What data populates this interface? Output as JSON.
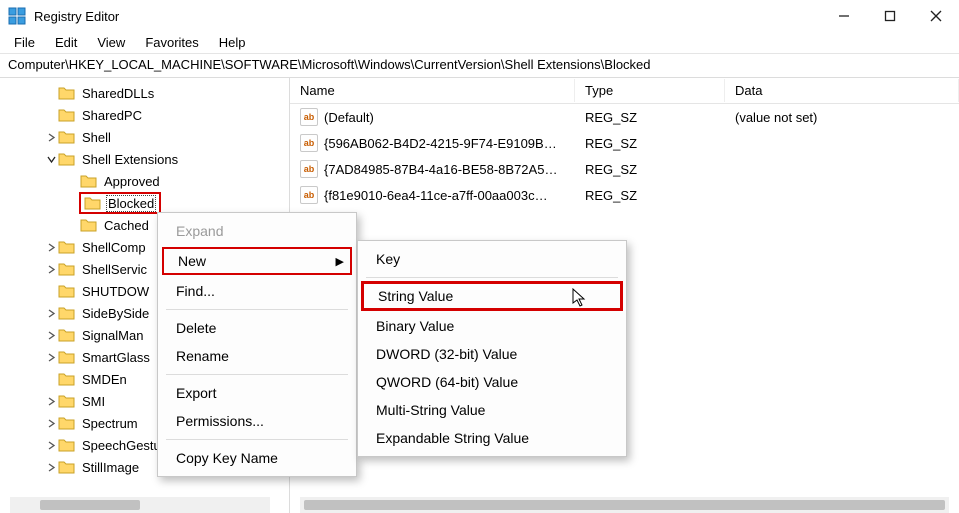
{
  "window": {
    "title": "Registry Editor"
  },
  "menubar": {
    "file": "File",
    "edit": "Edit",
    "view": "View",
    "favorites": "Favorites",
    "help": "Help"
  },
  "address": "Computer\\HKEY_LOCAL_MACHINE\\SOFTWARE\\Microsoft\\Windows\\CurrentVersion\\Shell Extensions\\Blocked",
  "tree": [
    {
      "label": "SharedDLLs",
      "indent": 38,
      "exp": ""
    },
    {
      "label": "SharedPC",
      "indent": 38,
      "exp": ""
    },
    {
      "label": "Shell",
      "indent": 38,
      "exp": "›",
      "exp_state": "collapsed"
    },
    {
      "label": "Shell Extensions",
      "indent": 38,
      "exp": "⌄",
      "exp_state": "expanded"
    },
    {
      "label": "Approved",
      "indent": 60,
      "exp": ""
    },
    {
      "label": "Blocked",
      "indent": 60,
      "exp": "",
      "selected": true,
      "highlight": true
    },
    {
      "label": "Cached",
      "indent": 60,
      "exp": ""
    },
    {
      "label": "ShellCompatibility",
      "display": "ShellComp",
      "indent": 38,
      "exp": "›"
    },
    {
      "label": "ShellServiceObjectDelayLoad",
      "display": "ShellServic",
      "indent": 38,
      "exp": "›"
    },
    {
      "label": "SHUTDOWN",
      "display": "SHUTDOW",
      "indent": 38,
      "exp": ""
    },
    {
      "label": "SideBySide",
      "display": "SideBySide",
      "indent": 38,
      "exp": "›"
    },
    {
      "label": "SignalManager",
      "display": "SignalMan",
      "indent": 38,
      "exp": "›"
    },
    {
      "label": "SmartGlass",
      "display": "SmartGlass",
      "indent": 38,
      "exp": "›"
    },
    {
      "label": "SMDEn",
      "indent": 38,
      "exp": ""
    },
    {
      "label": "SMI",
      "indent": 38,
      "exp": "›"
    },
    {
      "label": "Spectrum",
      "indent": 38,
      "exp": "›"
    },
    {
      "label": "SpeechGestures",
      "display": "SpeechGestures",
      "indent": 38,
      "exp": "›"
    },
    {
      "label": "StillImage",
      "indent": 38,
      "exp": "›"
    }
  ],
  "list": {
    "headers": {
      "name": "Name",
      "type": "Type",
      "data": "Data"
    },
    "rows": [
      {
        "name": "(Default)",
        "type": "REG_SZ",
        "data": "(value not set)"
      },
      {
        "name": "{596AB062-B4D2-4215-9F74-E9109B…",
        "type": "REG_SZ",
        "data": ""
      },
      {
        "name": "{7AD84985-87B4-4a16-BE58-8B72A5…",
        "type": "REG_SZ",
        "data": ""
      },
      {
        "name": "{f81e9010-6ea4-11ce-a7ff-00aa003c…",
        "type": "REG_SZ",
        "data": ""
      }
    ]
  },
  "context_menu": {
    "expand": "Expand",
    "new": "New",
    "find": "Find...",
    "delete": "Delete",
    "rename": "Rename",
    "export": "Export",
    "permissions": "Permissions...",
    "copy_key_name": "Copy Key Name"
  },
  "submenu": {
    "key": "Key",
    "string": "String Value",
    "binary": "Binary Value",
    "dword": "DWORD (32-bit) Value",
    "qword": "QWORD (64-bit) Value",
    "multi_string": "Multi-String Value",
    "expandable_string": "Expandable String Value"
  }
}
